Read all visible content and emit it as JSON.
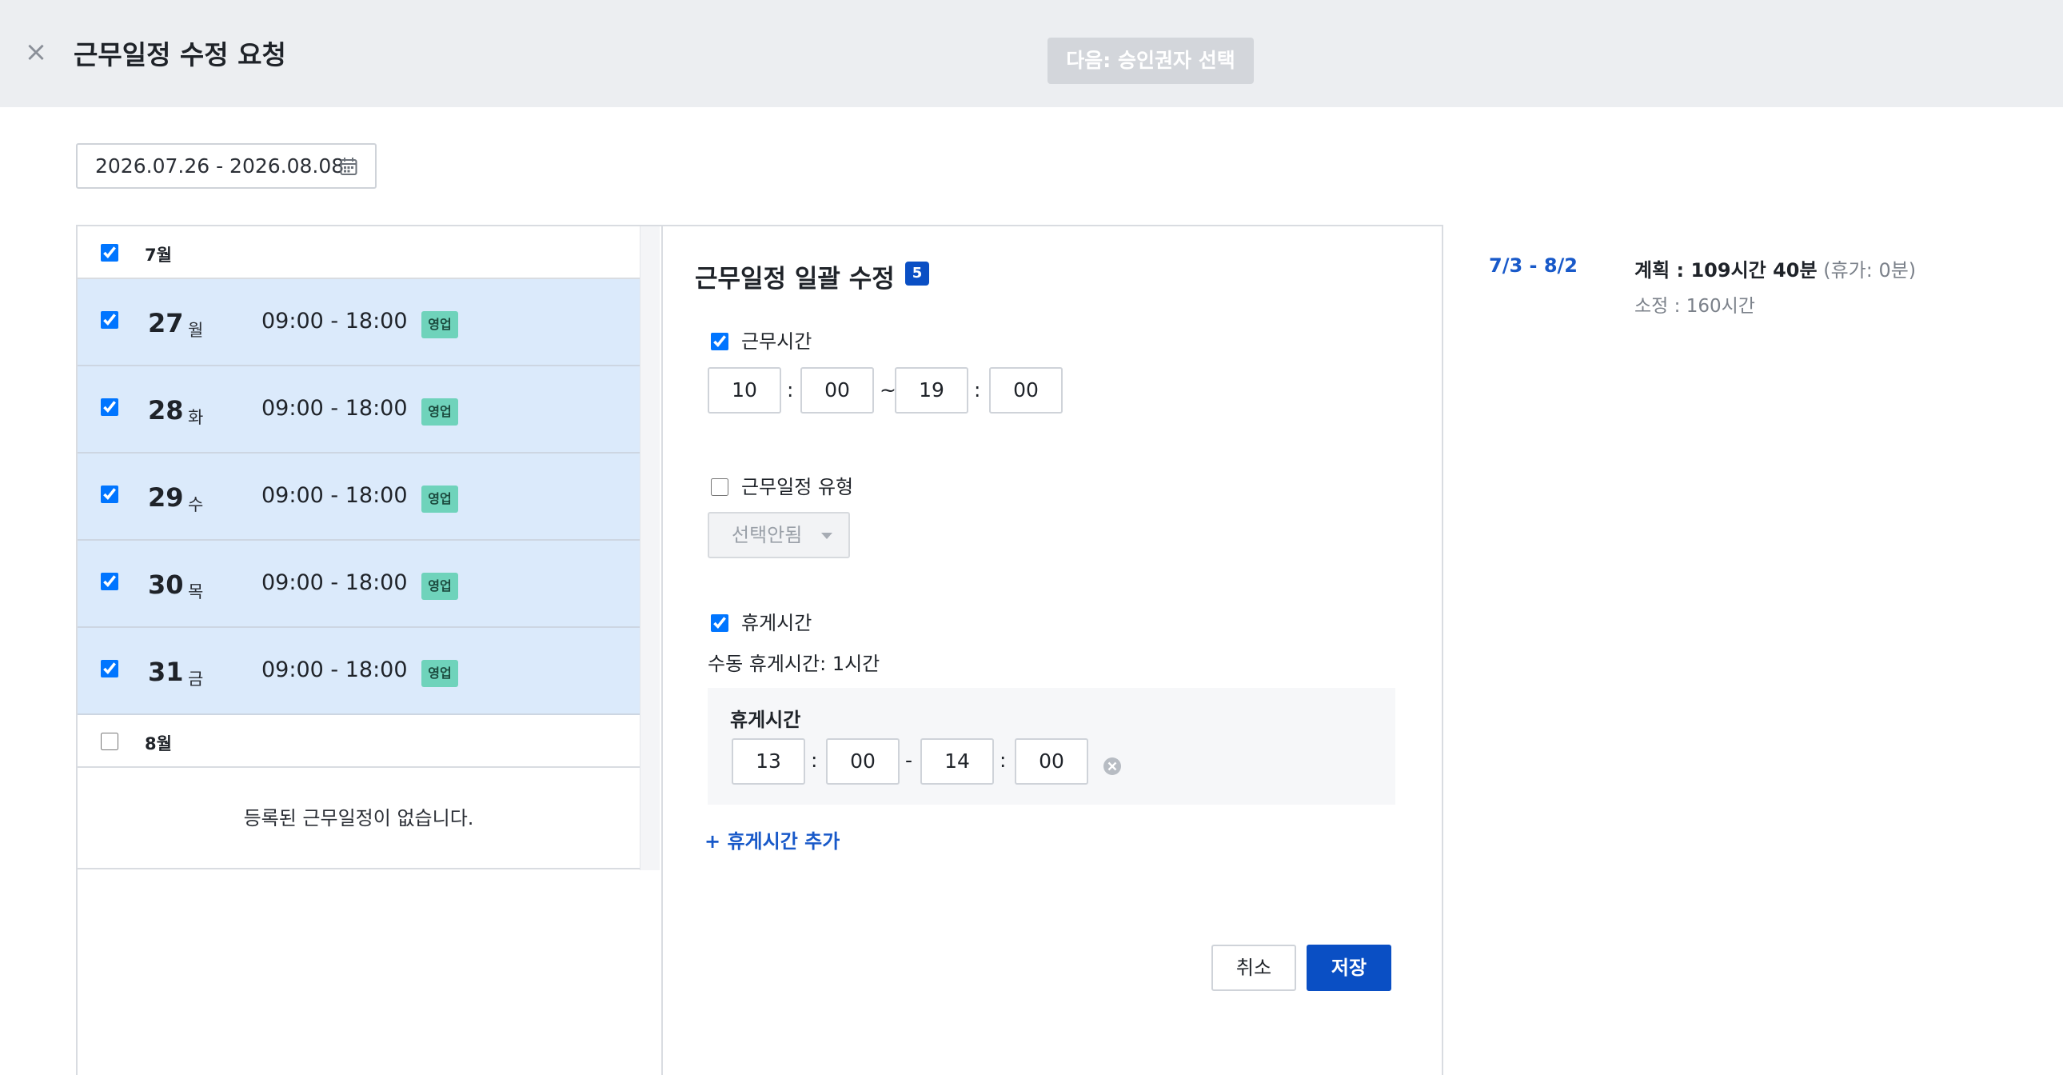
{
  "header": {
    "close_icon": "close-icon",
    "title": "근무일정 수정 요청",
    "next_button": "다음: 승인권자 선택"
  },
  "date_range": {
    "value": "2026.07.26 - 2026.08.08",
    "icon": "calendar-icon"
  },
  "schedule": {
    "july": {
      "label": "7월",
      "checked": true
    },
    "days": [
      {
        "num": "27",
        "weekday": "월",
        "time": "09:00 - 18:00",
        "badge": "영업",
        "checked": true
      },
      {
        "num": "28",
        "weekday": "화",
        "time": "09:00 - 18:00",
        "badge": "영업",
        "checked": true
      },
      {
        "num": "29",
        "weekday": "수",
        "time": "09:00 - 18:00",
        "badge": "영업",
        "checked": true
      },
      {
        "num": "30",
        "weekday": "목",
        "time": "09:00 - 18:00",
        "badge": "영업",
        "checked": true
      },
      {
        "num": "31",
        "weekday": "금",
        "time": "09:00 - 18:00",
        "badge": "영업",
        "checked": true
      }
    ],
    "august": {
      "label": "8월",
      "checked": false
    },
    "empty_message": "등록된 근무일정이 없습니다."
  },
  "bulk_edit": {
    "title": "근무일정 일괄 수정",
    "count": "5",
    "work_time": {
      "label": "근무시간",
      "checked": true,
      "start_hour": "10",
      "start_min": "00",
      "end_hour": "19",
      "end_min": "00",
      "colon": ":",
      "tilde": "~"
    },
    "schedule_type": {
      "label": "근무일정 유형",
      "checked": false,
      "select_value": "선택안됨"
    },
    "break_time": {
      "label": "휴게시간",
      "checked": true,
      "manual_text": "수동 휴게시간: 1시간",
      "box_label": "휴게시간",
      "start_hour": "13",
      "start_min": "00",
      "end_hour": "14",
      "end_min": "00",
      "dash": "-",
      "remove_icon": "remove-circle-icon"
    },
    "add_break": "+ 휴게시간 추가",
    "cancel": "취소",
    "save": "저장"
  },
  "summary": {
    "period": "7/3 - 8/2",
    "plan_label": "계획 : 109시간 40분",
    "plan_vacation": "(휴가: 0분)",
    "fixed": "소정 : 160시간"
  },
  "colors": {
    "accent": "#0a4fc4",
    "link": "#1859c9",
    "selected_row": "#dbeafb",
    "badge": "#6fd3bb",
    "header_bg": "#eceef1"
  }
}
